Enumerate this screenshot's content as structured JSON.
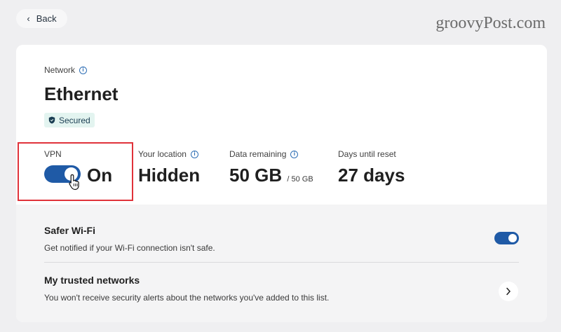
{
  "header": {
    "back_label": "Back",
    "watermark": "groovyPost.com"
  },
  "network": {
    "label": "Network",
    "name": "Ethernet",
    "badge": "Secured"
  },
  "vpn": {
    "label": "VPN",
    "state": "On",
    "enabled": true
  },
  "stats": {
    "location": {
      "label": "Your location",
      "value": "Hidden"
    },
    "data": {
      "label": "Data remaining",
      "value": "50 GB",
      "sub": "/ 50 GB"
    },
    "reset": {
      "label": "Days until reset",
      "value": "27 days"
    }
  },
  "settings": {
    "safer_wifi": {
      "title": "Safer Wi-Fi",
      "desc": "Get notified if your Wi-Fi connection isn't safe.",
      "enabled": true
    },
    "trusted": {
      "title": "My trusted networks",
      "desc": "You won't receive security alerts about the networks you've added to this list."
    }
  },
  "colors": {
    "accent": "#1f5aa6",
    "highlight": "#e0323a",
    "badge_bg": "#e3f4f0"
  }
}
